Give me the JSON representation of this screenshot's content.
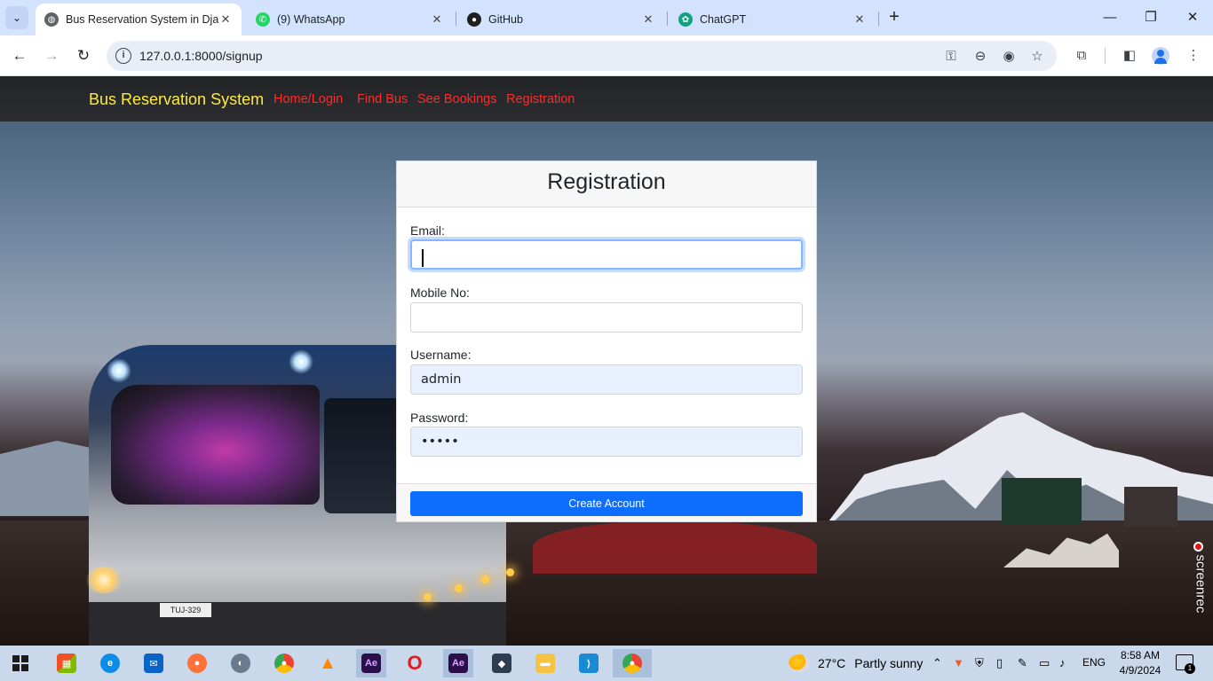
{
  "browser": {
    "tabs": [
      {
        "title": "Bus Reservation System in Djan",
        "active": true,
        "favicon": "globe-icon"
      },
      {
        "title": "(9) WhatsApp",
        "active": false,
        "favicon": "whatsapp-icon"
      },
      {
        "title": "GitHub",
        "active": false,
        "favicon": "github-icon"
      },
      {
        "title": "ChatGPT",
        "active": false,
        "favicon": "chatgpt-icon"
      }
    ],
    "url": "127.0.0.1:8000/signup"
  },
  "site": {
    "brand": "Bus Reservation System",
    "nav": [
      "Home/Login",
      "Find Bus",
      "See Bookings",
      "Registration"
    ],
    "brand_color": "#ffeb3b",
    "link_color": "#ff2a2a"
  },
  "form": {
    "title": "Registration",
    "fields": [
      {
        "label": "Email:",
        "value": ""
      },
      {
        "label": "Mobile No:",
        "value": ""
      },
      {
        "label": "Username:",
        "value": "admin"
      },
      {
        "label": "Password:",
        "value": "•••••"
      }
    ],
    "submit_label": "Create Account",
    "accent_color": "#0d6efd"
  },
  "scene": {
    "plate": "TUJ-329",
    "recorder": "screenrec"
  },
  "taskbar": {
    "weather_temp": "27°C",
    "weather_text": "Partly sunny",
    "language": "ENG",
    "time": "8:58 AM",
    "date": "4/9/2024",
    "notifications": "1",
    "apps": [
      "Ae",
      "Ae"
    ]
  }
}
